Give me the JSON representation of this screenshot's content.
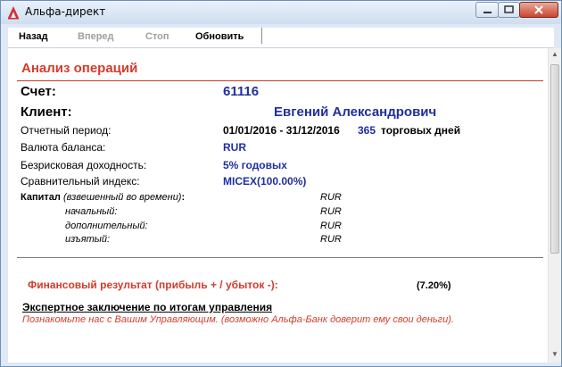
{
  "window": {
    "title": "Альфа-директ"
  },
  "toolbar": {
    "back": "Назад",
    "forward": "Вперед",
    "stop": "Стоп",
    "refresh": "Обновить"
  },
  "report": {
    "heading": "Анализ операций",
    "account_label": "Счет:",
    "account_value": "61116",
    "client_label": "Клиент:",
    "client_value": "Евгений Александрович",
    "period_label": "Отчетный период:",
    "period_value": "01/01/2016 - 31/12/2016",
    "trading_days_count": "365",
    "trading_days_text": "торговых дней",
    "currency_label": "Валюта баланса:",
    "currency_value": "RUR",
    "riskfree_label": "Безрисковая доходность:",
    "riskfree_value": "5% годовых",
    "benchmark_label": "Сравнительный индекс:",
    "benchmark_value": "MICEX(100.00%)",
    "capital_label": "Капитал",
    "capital_note": "(взвешенный во времени)",
    "capital_colon": ":",
    "capital_currency": "RUR",
    "initial_label": "начальный:",
    "initial_currency": "RUR",
    "additional_label": "дополнительный:",
    "additional_currency": "RUR",
    "withdrawn_label": "изъятый:",
    "withdrawn_currency": "RUR",
    "financial_result_label": "Финансовый результат (прибыль + / убыток -):",
    "financial_result_value": "(7.20%)",
    "expert_title": "Экспертное заключение по итогам управления",
    "expert_note": "Познакомьте нас с Вашим Управляющим. (возможно Альфа-Банк доверит ему свои деньги)."
  },
  "colors": {
    "accent_red": "#d33c2b",
    "value_blue": "#1f2fa0"
  }
}
